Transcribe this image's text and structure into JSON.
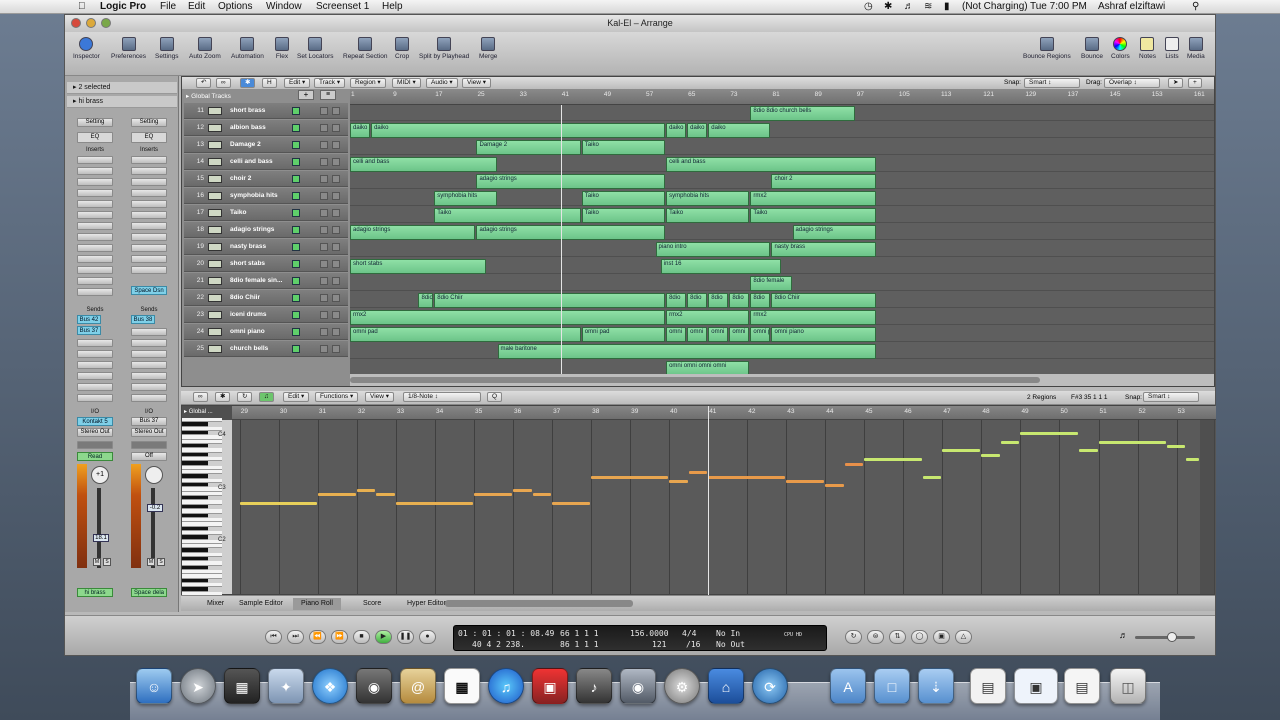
{
  "menubar": {
    "app": "Logic Pro",
    "menus": [
      "File",
      "Edit",
      "Options",
      "Window",
      "Screenset 1",
      "Help"
    ],
    "battery_text": "(Not Charging)",
    "clock": "Tue 7:00 PM",
    "user": "Ashraf elziftawi"
  },
  "window": {
    "title": "Kal-El – Arrange"
  },
  "toolbar": {
    "left": [
      "Inspector",
      "Preferences",
      "Settings",
      "Auto Zoom",
      "Automation",
      "Flex",
      "Set Locators",
      "Repeat Section",
      "Crop",
      "Split by Playhead",
      "Merge"
    ],
    "right": [
      "Bounce Regions",
      "Bounce",
      "Colors",
      "Notes",
      "Lists",
      "Media"
    ]
  },
  "inspector": {
    "region_header": "2 selected",
    "track_header": "hi brass",
    "strip1": {
      "setting": "Setting",
      "eq": "EQ",
      "inserts": "Inserts",
      "sends": "Sends",
      "send1": "Bus 42",
      "send2": "Bus 37",
      "io": "I/O",
      "input": "Kontakt 5",
      "output": "Stereo Out",
      "mode": "Read",
      "pan": "+1",
      "vol": "18.1",
      "m": "M",
      "s": "S",
      "name": "hi brass"
    },
    "strip2": {
      "setting": "Setting",
      "eq": "EQ",
      "inserts": "Inserts",
      "insert1": "Space Dsn",
      "sends": "Sends",
      "send1": "Bus 38",
      "io": "I/O",
      "input": "Bus 37",
      "output": "Stereo Out",
      "mode": "Off",
      "vol": "-0.2",
      "m": "M",
      "s": "S",
      "name": "Space dela"
    }
  },
  "arrange": {
    "menus": [
      "Edit",
      "Track",
      "Region",
      "MIDI",
      "Audio",
      "View"
    ],
    "snap_label": "Snap:",
    "snap_value": "Smart",
    "drag_label": "Drag:",
    "drag_value": "Overlap",
    "global_tracks": "Global Tracks",
    "ruler": [
      "1",
      "9",
      "17",
      "25",
      "33",
      "41",
      "49",
      "57",
      "65",
      "73",
      "81",
      "89",
      "97",
      "105",
      "113",
      "121",
      "129",
      "137",
      "145",
      "153",
      "161"
    ],
    "tracks": [
      {
        "num": "11",
        "name": "short brass"
      },
      {
        "num": "12",
        "name": "albion bass"
      },
      {
        "num": "13",
        "name": "Damage 2"
      },
      {
        "num": "14",
        "name": "celli and bass"
      },
      {
        "num": "15",
        "name": "choir 2"
      },
      {
        "num": "16",
        "name": "symphobia hits"
      },
      {
        "num": "17",
        "name": "Taiko"
      },
      {
        "num": "18",
        "name": "adagio strings"
      },
      {
        "num": "19",
        "name": "nasty brass"
      },
      {
        "num": "20",
        "name": "short stabs"
      },
      {
        "num": "21",
        "name": "8dio female sin..."
      },
      {
        "num": "22",
        "name": "8dio Chiir"
      },
      {
        "num": "23",
        "name": "iceni drums"
      },
      {
        "num": "24",
        "name": "omni piano"
      },
      {
        "num": "25",
        "name": "church bells"
      }
    ],
    "regions": [
      {
        "row": 0,
        "start": 77,
        "end": 97,
        "label": "8dio 8dio church bells"
      },
      {
        "row": 1,
        "start": 1,
        "end": 5,
        "label": "daiko"
      },
      {
        "row": 1,
        "start": 5,
        "end": 61,
        "label": "daiko"
      },
      {
        "row": 1,
        "start": 61,
        "end": 65,
        "label": "daiko"
      },
      {
        "row": 1,
        "start": 65,
        "end": 69,
        "label": "daiko"
      },
      {
        "row": 1,
        "start": 69,
        "end": 81,
        "label": "daiko"
      },
      {
        "row": 2,
        "start": 25,
        "end": 45,
        "label": "Damage 2"
      },
      {
        "row": 2,
        "start": 45,
        "end": 61,
        "label": "Taiko"
      },
      {
        "row": 3,
        "start": 1,
        "end": 29,
        "label": "celli and bass"
      },
      {
        "row": 3,
        "start": 61,
        "end": 101,
        "label": "celli and bass"
      },
      {
        "row": 4,
        "start": 25,
        "end": 61,
        "label": "adagio strings"
      },
      {
        "row": 4,
        "start": 81,
        "end": 101,
        "label": "choir 2"
      },
      {
        "row": 5,
        "start": 17,
        "end": 29,
        "label": "symphobia hits"
      },
      {
        "row": 5,
        "start": 45,
        "end": 61,
        "label": "Taiko"
      },
      {
        "row": 5,
        "start": 61,
        "end": 77,
        "label": "symphobia hits"
      },
      {
        "row": 5,
        "start": 77,
        "end": 101,
        "label": "rmx2"
      },
      {
        "row": 6,
        "start": 17,
        "end": 45,
        "label": "Taiko"
      },
      {
        "row": 6,
        "start": 45,
        "end": 61,
        "label": "Taiko"
      },
      {
        "row": 6,
        "start": 61,
        "end": 77,
        "label": "Taiko"
      },
      {
        "row": 6,
        "start": 77,
        "end": 101,
        "label": "Taiko"
      },
      {
        "row": 7,
        "start": 1,
        "end": 25,
        "label": "adagio strings"
      },
      {
        "row": 7,
        "start": 25,
        "end": 61,
        "label": "adagio strings"
      },
      {
        "row": 7,
        "start": 85,
        "end": 101,
        "label": "adagio strings"
      },
      {
        "row": 8,
        "start": 59,
        "end": 81,
        "label": "piano intro"
      },
      {
        "row": 8,
        "start": 81,
        "end": 101,
        "label": "nasty brass"
      },
      {
        "row": 9,
        "start": 1,
        "end": 27,
        "label": "short stabs"
      },
      {
        "row": 9,
        "start": 60,
        "end": 83,
        "label": "inst 16"
      },
      {
        "row": 10,
        "start": 77,
        "end": 85,
        "label": "8dio female"
      },
      {
        "row": 11,
        "start": 14,
        "end": 17,
        "label": "8dio"
      },
      {
        "row": 11,
        "start": 17,
        "end": 61,
        "label": "8dio Chiir"
      },
      {
        "row": 11,
        "start": 61,
        "end": 65,
        "label": "8dio"
      },
      {
        "row": 11,
        "start": 65,
        "end": 69,
        "label": "8dio"
      },
      {
        "row": 11,
        "start": 69,
        "end": 73,
        "label": "8dio"
      },
      {
        "row": 11,
        "start": 73,
        "end": 77,
        "label": "8dio"
      },
      {
        "row": 11,
        "start": 77,
        "end": 81,
        "label": "8dio"
      },
      {
        "row": 11,
        "start": 81,
        "end": 101,
        "label": "8dio Chiir"
      },
      {
        "row": 12,
        "start": 1,
        "end": 61,
        "label": "rmx2"
      },
      {
        "row": 12,
        "start": 61,
        "end": 77,
        "label": "rmx2"
      },
      {
        "row": 12,
        "start": 77,
        "end": 101,
        "label": "rmx2"
      },
      {
        "row": 13,
        "start": 1,
        "end": 45,
        "label": "omni pad"
      },
      {
        "row": 13,
        "start": 45,
        "end": 61,
        "label": "omni pad"
      },
      {
        "row": 13,
        "start": 61,
        "end": 65,
        "label": "omni"
      },
      {
        "row": 13,
        "start": 65,
        "end": 69,
        "label": "omni"
      },
      {
        "row": 13,
        "start": 69,
        "end": 73,
        "label": "omni"
      },
      {
        "row": 13,
        "start": 73,
        "end": 77,
        "label": "omni"
      },
      {
        "row": 13,
        "start": 77,
        "end": 81,
        "label": "omni piano"
      },
      {
        "row": 13,
        "start": 81,
        "end": 101,
        "label": "omni piano"
      },
      {
        "row": 14,
        "start": 29,
        "end": 101,
        "label": "male baritone"
      },
      {
        "row": 15,
        "start": 61,
        "end": 77,
        "label": "omni omni omni omni"
      }
    ]
  },
  "editor": {
    "menus": [
      "Edit",
      "Functions",
      "View"
    ],
    "quantize": "1/8-Note",
    "q": "Q",
    "regions_count": "2 Regions",
    "position": "F#3  35 1 1 1",
    "snap_label": "Snap:",
    "snap_value": "Smart",
    "global_label": "Global ...",
    "ruler": [
      "29",
      "30",
      "31",
      "32",
      "33",
      "34",
      "35",
      "36",
      "37",
      "38",
      "39",
      "40",
      "41",
      "42",
      "43",
      "44",
      "45",
      "46",
      "47",
      "48",
      "49",
      "50",
      "51",
      "52",
      "53"
    ],
    "key_labels": [
      "C4",
      "C3",
      "C2"
    ],
    "tabs": [
      "Mixer",
      "Sample Editor",
      "Piano Roll",
      "Score",
      "Hyper Editor"
    ],
    "notes": [
      {
        "start": 29.0,
        "end": 31.0,
        "pitch": 57,
        "color": "#e8d05a"
      },
      {
        "start": 31.0,
        "end": 32.0,
        "pitch": 59,
        "color": "#e8b050"
      },
      {
        "start": 32.0,
        "end": 32.5,
        "pitch": 60,
        "color": "#e8b050"
      },
      {
        "start": 32.5,
        "end": 33.0,
        "pitch": 59,
        "color": "#e8b050"
      },
      {
        "start": 33.0,
        "end": 35.0,
        "pitch": 57,
        "color": "#e8b050"
      },
      {
        "start": 35.0,
        "end": 36.0,
        "pitch": 59,
        "color": "#e8a650"
      },
      {
        "start": 36.0,
        "end": 36.5,
        "pitch": 60,
        "color": "#e8a650"
      },
      {
        "start": 36.5,
        "end": 37.0,
        "pitch": 59,
        "color": "#e8a650"
      },
      {
        "start": 37.0,
        "end": 38.0,
        "pitch": 57,
        "color": "#e8a650"
      },
      {
        "start": 38.0,
        "end": 40.0,
        "pitch": 63,
        "color": "#e8a650"
      },
      {
        "start": 40.0,
        "end": 40.5,
        "pitch": 62,
        "color": "#e8a650"
      },
      {
        "start": 40.5,
        "end": 41.0,
        "pitch": 64,
        "color": "#e89a4a"
      },
      {
        "start": 41.0,
        "end": 43.0,
        "pitch": 63,
        "color": "#e89a4a"
      },
      {
        "start": 43.0,
        "end": 44.0,
        "pitch": 62,
        "color": "#e89a4a"
      },
      {
        "start": 44.0,
        "end": 44.5,
        "pitch": 61,
        "color": "#e89a4a"
      },
      {
        "start": 44.5,
        "end": 45.0,
        "pitch": 66,
        "color": "#e8904a"
      },
      {
        "start": 45.0,
        "end": 46.5,
        "pitch": 67,
        "color": "#c8e870"
      },
      {
        "start": 46.5,
        "end": 47.0,
        "pitch": 63,
        "color": "#c8e870"
      },
      {
        "start": 47.0,
        "end": 48.0,
        "pitch": 69,
        "color": "#c8e870"
      },
      {
        "start": 48.0,
        "end": 48.5,
        "pitch": 68,
        "color": "#c8e870"
      },
      {
        "start": 48.5,
        "end": 49.0,
        "pitch": 71,
        "color": "#c8e870"
      },
      {
        "start": 49.0,
        "end": 50.5,
        "pitch": 73,
        "color": "#c8e870"
      },
      {
        "start": 50.5,
        "end": 51.0,
        "pitch": 69,
        "color": "#c8e870"
      },
      {
        "start": 51.0,
        "end": 52.75,
        "pitch": 71,
        "color": "#c8e870"
      },
      {
        "start": 52.75,
        "end": 53.25,
        "pitch": 70,
        "color": "#c8e870"
      },
      {
        "start": 53.25,
        "end": 53.6,
        "pitch": 67,
        "color": "#c8e870"
      }
    ]
  },
  "transport": {
    "smpte": "01 : 01 : 01 : 08.49",
    "smpte2": "40    4    2  238.",
    "bars": "66    1    1    1",
    "bars2": "86    1    1    1",
    "tempo": "156.0000",
    "tempo2": "121",
    "sig": "4/4",
    "sig2": "/16",
    "midi_in": "No In",
    "midi_out": "No Out",
    "cpu": "CPU  HD"
  }
}
